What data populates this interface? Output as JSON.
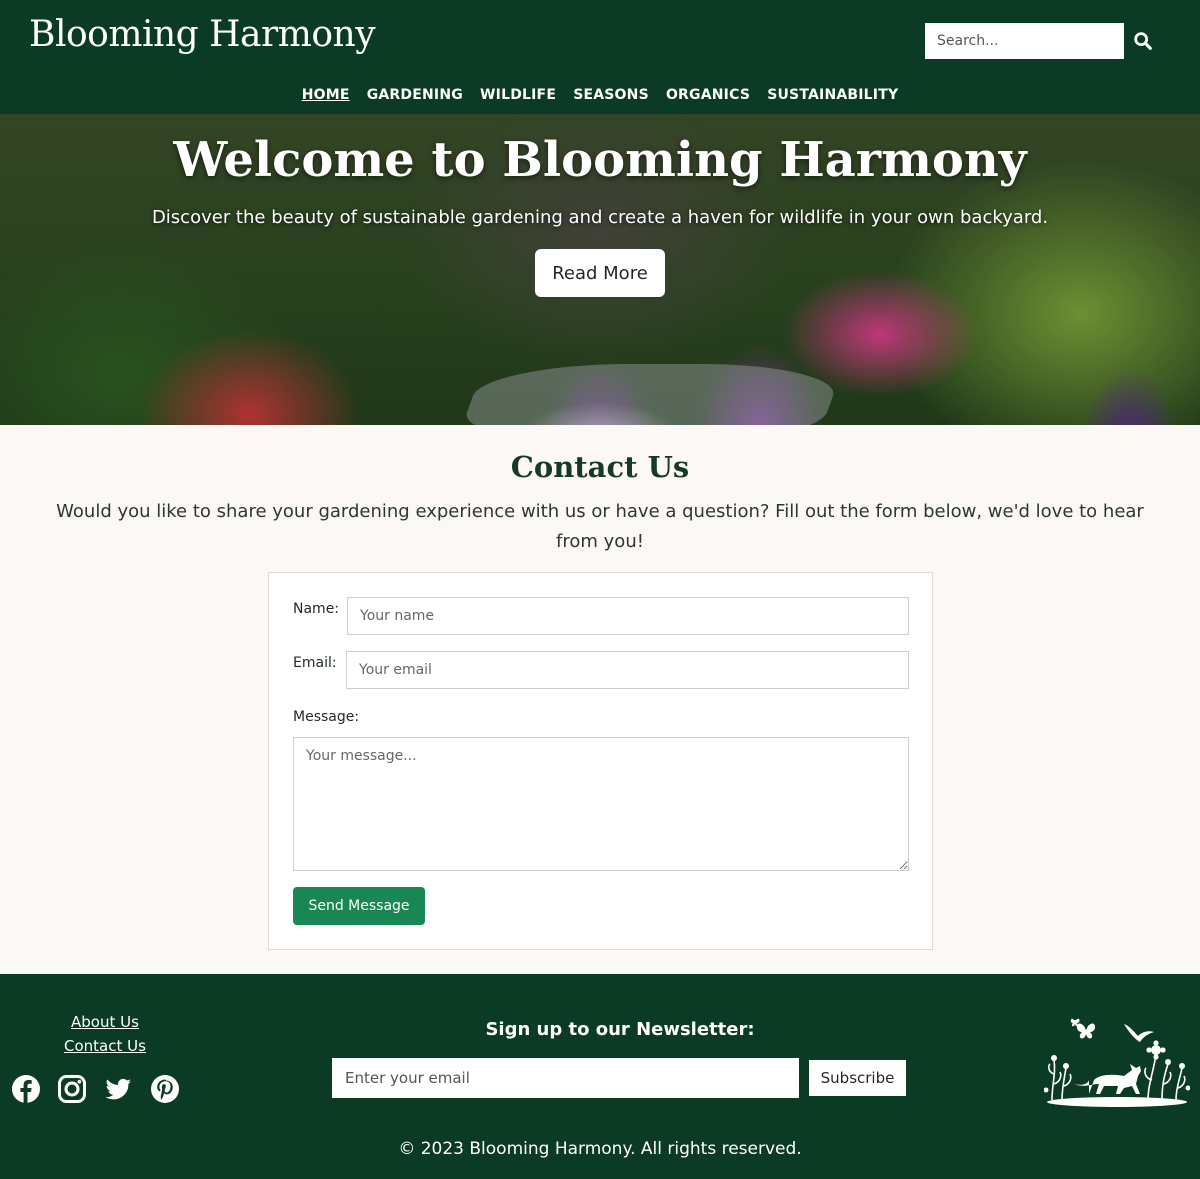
{
  "header": {
    "logo": "Blooming Harmony",
    "search_placeholder": "Search...",
    "nav": [
      "HOME",
      "GARDENING",
      "WILDLIFE",
      "SEASONS",
      "ORGANICS",
      "SUSTAINABILITY"
    ]
  },
  "hero": {
    "title": "Welcome to Blooming Harmony",
    "subtitle": "Discover the beauty of sustainable gardening and create a haven for wildlife in your own backyard.",
    "button": "Read More"
  },
  "contact": {
    "title": "Contact Us",
    "intro": "Would you like to share your gardening experience with us or have a question? Fill out the form below, we'd love to hear from you!",
    "name_label": "Name:",
    "name_placeholder": "Your name",
    "email_label": "Email:",
    "email_placeholder": "Your email",
    "message_label": "Message:",
    "message_placeholder": "Your message...",
    "send_button": "Send Message"
  },
  "footer": {
    "links": [
      "About Us",
      "Contact Us"
    ],
    "social": [
      "facebook-icon",
      "instagram-icon",
      "twitter-icon",
      "pinterest-icon"
    ],
    "newsletter_title": "Sign up to our Newsletter:",
    "newsletter_placeholder": "Enter your email",
    "subscribe_button": "Subscribe",
    "copyright": "© 2023 Blooming Harmony. All rights reserved."
  },
  "colors": {
    "primary": "#0b3b24",
    "accent": "#198754",
    "background": "#fcf8f5"
  }
}
